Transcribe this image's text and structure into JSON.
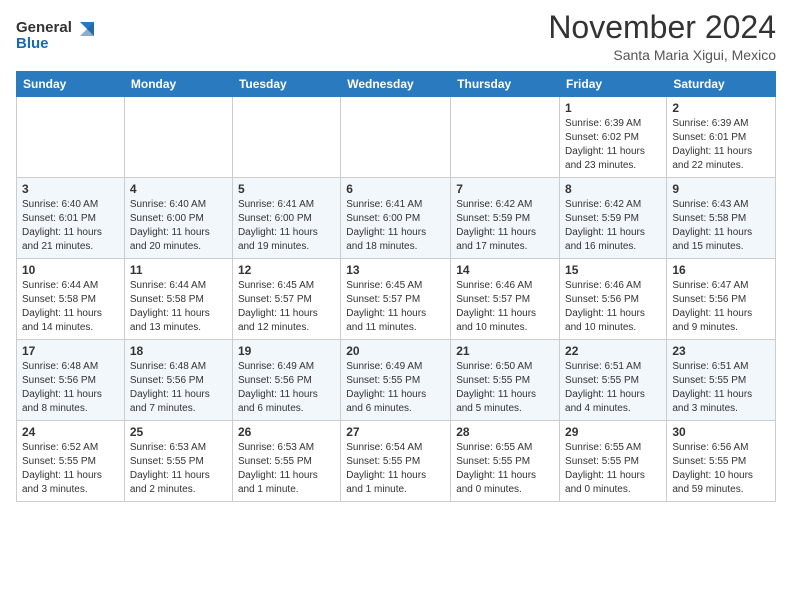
{
  "header": {
    "logo_line1": "General",
    "logo_line2": "Blue",
    "month": "November 2024",
    "location": "Santa Maria Xigui, Mexico"
  },
  "weekdays": [
    "Sunday",
    "Monday",
    "Tuesday",
    "Wednesday",
    "Thursday",
    "Friday",
    "Saturday"
  ],
  "weeks": [
    [
      {
        "day": "",
        "info": ""
      },
      {
        "day": "",
        "info": ""
      },
      {
        "day": "",
        "info": ""
      },
      {
        "day": "",
        "info": ""
      },
      {
        "day": "",
        "info": ""
      },
      {
        "day": "1",
        "info": "Sunrise: 6:39 AM\nSunset: 6:02 PM\nDaylight: 11 hours\nand 23 minutes."
      },
      {
        "day": "2",
        "info": "Sunrise: 6:39 AM\nSunset: 6:01 PM\nDaylight: 11 hours\nand 22 minutes."
      }
    ],
    [
      {
        "day": "3",
        "info": "Sunrise: 6:40 AM\nSunset: 6:01 PM\nDaylight: 11 hours\nand 21 minutes."
      },
      {
        "day": "4",
        "info": "Sunrise: 6:40 AM\nSunset: 6:00 PM\nDaylight: 11 hours\nand 20 minutes."
      },
      {
        "day": "5",
        "info": "Sunrise: 6:41 AM\nSunset: 6:00 PM\nDaylight: 11 hours\nand 19 minutes."
      },
      {
        "day": "6",
        "info": "Sunrise: 6:41 AM\nSunset: 6:00 PM\nDaylight: 11 hours\nand 18 minutes."
      },
      {
        "day": "7",
        "info": "Sunrise: 6:42 AM\nSunset: 5:59 PM\nDaylight: 11 hours\nand 17 minutes."
      },
      {
        "day": "8",
        "info": "Sunrise: 6:42 AM\nSunset: 5:59 PM\nDaylight: 11 hours\nand 16 minutes."
      },
      {
        "day": "9",
        "info": "Sunrise: 6:43 AM\nSunset: 5:58 PM\nDaylight: 11 hours\nand 15 minutes."
      }
    ],
    [
      {
        "day": "10",
        "info": "Sunrise: 6:44 AM\nSunset: 5:58 PM\nDaylight: 11 hours\nand 14 minutes."
      },
      {
        "day": "11",
        "info": "Sunrise: 6:44 AM\nSunset: 5:58 PM\nDaylight: 11 hours\nand 13 minutes."
      },
      {
        "day": "12",
        "info": "Sunrise: 6:45 AM\nSunset: 5:57 PM\nDaylight: 11 hours\nand 12 minutes."
      },
      {
        "day": "13",
        "info": "Sunrise: 6:45 AM\nSunset: 5:57 PM\nDaylight: 11 hours\nand 11 minutes."
      },
      {
        "day": "14",
        "info": "Sunrise: 6:46 AM\nSunset: 5:57 PM\nDaylight: 11 hours\nand 10 minutes."
      },
      {
        "day": "15",
        "info": "Sunrise: 6:46 AM\nSunset: 5:56 PM\nDaylight: 11 hours\nand 10 minutes."
      },
      {
        "day": "16",
        "info": "Sunrise: 6:47 AM\nSunset: 5:56 PM\nDaylight: 11 hours\nand 9 minutes."
      }
    ],
    [
      {
        "day": "17",
        "info": "Sunrise: 6:48 AM\nSunset: 5:56 PM\nDaylight: 11 hours\nand 8 minutes."
      },
      {
        "day": "18",
        "info": "Sunrise: 6:48 AM\nSunset: 5:56 PM\nDaylight: 11 hours\nand 7 minutes."
      },
      {
        "day": "19",
        "info": "Sunrise: 6:49 AM\nSunset: 5:56 PM\nDaylight: 11 hours\nand 6 minutes."
      },
      {
        "day": "20",
        "info": "Sunrise: 6:49 AM\nSunset: 5:55 PM\nDaylight: 11 hours\nand 6 minutes."
      },
      {
        "day": "21",
        "info": "Sunrise: 6:50 AM\nSunset: 5:55 PM\nDaylight: 11 hours\nand 5 minutes."
      },
      {
        "day": "22",
        "info": "Sunrise: 6:51 AM\nSunset: 5:55 PM\nDaylight: 11 hours\nand 4 minutes."
      },
      {
        "day": "23",
        "info": "Sunrise: 6:51 AM\nSunset: 5:55 PM\nDaylight: 11 hours\nand 3 minutes."
      }
    ],
    [
      {
        "day": "24",
        "info": "Sunrise: 6:52 AM\nSunset: 5:55 PM\nDaylight: 11 hours\nand 3 minutes."
      },
      {
        "day": "25",
        "info": "Sunrise: 6:53 AM\nSunset: 5:55 PM\nDaylight: 11 hours\nand 2 minutes."
      },
      {
        "day": "26",
        "info": "Sunrise: 6:53 AM\nSunset: 5:55 PM\nDaylight: 11 hours\nand 1 minute."
      },
      {
        "day": "27",
        "info": "Sunrise: 6:54 AM\nSunset: 5:55 PM\nDaylight: 11 hours\nand 1 minute."
      },
      {
        "day": "28",
        "info": "Sunrise: 6:55 AM\nSunset: 5:55 PM\nDaylight: 11 hours\nand 0 minutes."
      },
      {
        "day": "29",
        "info": "Sunrise: 6:55 AM\nSunset: 5:55 PM\nDaylight: 11 hours\nand 0 minutes."
      },
      {
        "day": "30",
        "info": "Sunrise: 6:56 AM\nSunset: 5:55 PM\nDaylight: 10 hours\nand 59 minutes."
      }
    ]
  ]
}
